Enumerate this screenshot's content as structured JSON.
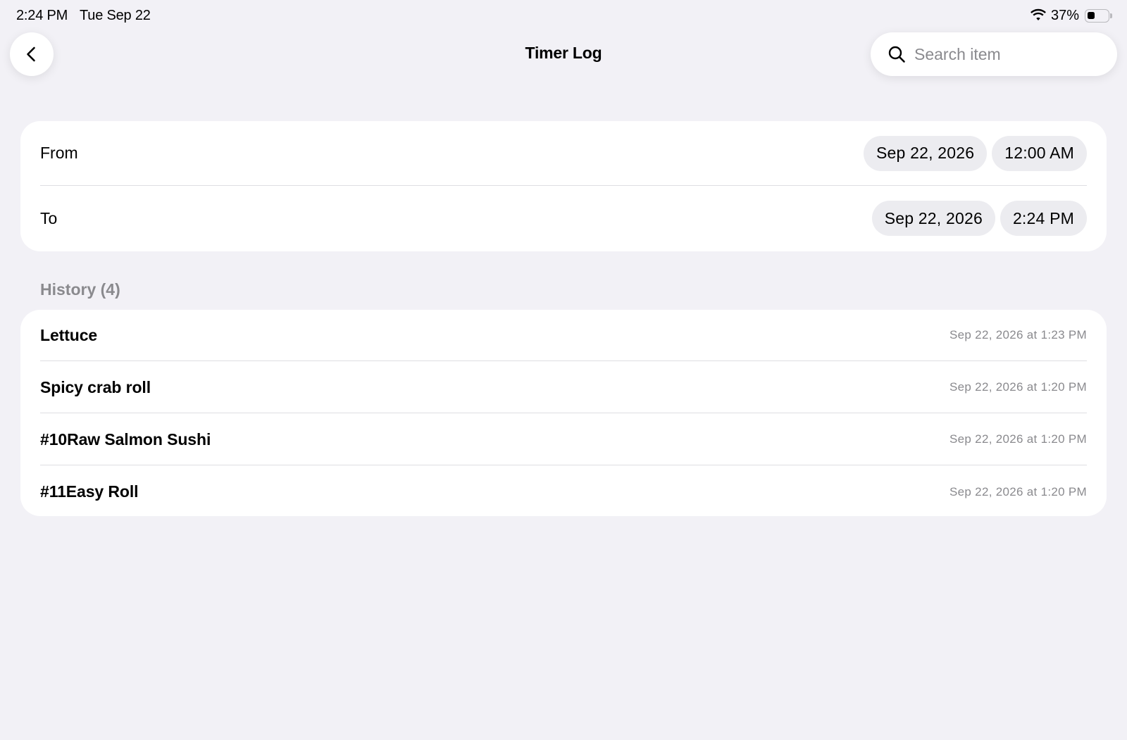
{
  "status_bar": {
    "time": "2:24 PM",
    "date": "Tue Sep 22",
    "battery_percent": "37%",
    "battery_level": 0.37
  },
  "nav": {
    "title": "Timer Log",
    "back_icon": "chevron-left-icon",
    "search": {
      "placeholder": "Search item",
      "value": "",
      "icon": "search-icon"
    }
  },
  "range": {
    "from": {
      "label": "From",
      "date": "Sep 22, 2026",
      "time": "12:00 AM"
    },
    "to": {
      "label": "To",
      "date": "Sep 22, 2026",
      "time": "2:24 PM"
    }
  },
  "history": {
    "header": "History (4)",
    "items": [
      {
        "name": "Lettuce",
        "timestamp": "Sep 22, 2026 at 1:23 PM"
      },
      {
        "name": "Spicy crab roll",
        "timestamp": "Sep 22, 2026 at 1:20 PM"
      },
      {
        "name": "#10Raw Salmon Sushi",
        "timestamp": "Sep 22, 2026 at 1:20 PM"
      },
      {
        "name": "#11Easy Roll",
        "timestamp": "Sep 22, 2026 at 1:20 PM"
      }
    ]
  },
  "colors": {
    "background": "#f2f1f6",
    "card": "#ffffff",
    "pill": "#ececf0",
    "secondary_text": "#8a8a8e",
    "divider": "#dedee2"
  }
}
